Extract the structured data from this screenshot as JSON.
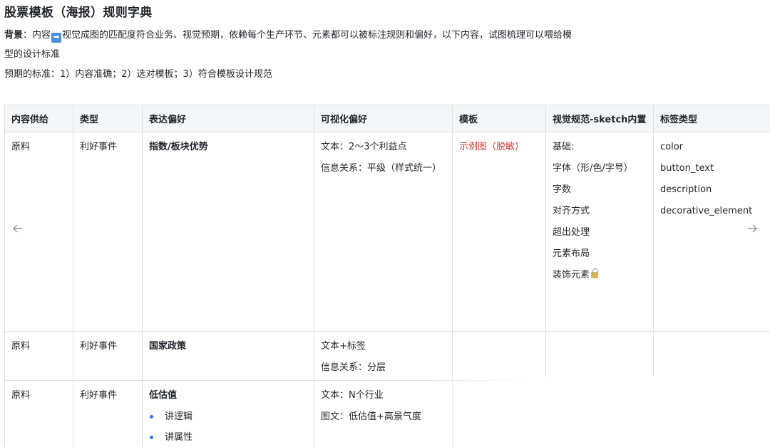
{
  "doc": {
    "title": "股票模板（海报）规则字典",
    "background_label": "背景",
    "background_colon": "：",
    "background_text_a": "内容",
    "background_text_b": "视觉成图的匹配度符合业务、视觉预期，依赖每个生产环节、元素都可以被标注规则和偏好，以下内容，试图梳理可以喂给模型的设计标准",
    "standard_line": "预期的标准：1）内容准确；2）选对模板；3）符合模板设计规范"
  },
  "icons": {
    "arrow_emoji": "right-arrow-emoji-icon",
    "lock": "lock-icon",
    "prev": "arrow-left-icon",
    "next": "arrow-right-icon"
  },
  "colors": {
    "header_bg": "#f5f6f7",
    "border": "#dee0e3",
    "link_red": "#d83931",
    "bullet_blue": "#3370ff"
  },
  "table": {
    "headers": [
      "内容供给",
      "类型",
      "表达偏好",
      "可视化偏好",
      "模板",
      "视觉规范-sketch内置",
      "标签类型"
    ],
    "rows": [
      {
        "supply": "原料",
        "type": "利好事件",
        "expression": "指数/板块优势",
        "visual": [
          "文本：2～3个利益点",
          "信息关系：平级（样式统一）"
        ],
        "template": "示例图（脱敏）",
        "spec": [
          "基础:",
          "字体（形/色/字号）",
          "字数",
          "对齐方式",
          "超出处理",
          "元素布局",
          "装饰元素"
        ],
        "tags": [
          "color",
          "button_text",
          "description",
          "decorative_element"
        ]
      },
      {
        "supply": "原料",
        "type": "利好事件",
        "expression": "国家政策",
        "visual": [
          "文本+标签",
          "信息关系：分层"
        ]
      },
      {
        "supply": "原料",
        "type": "利好事件",
        "expression": "低估值",
        "expression_bullets": [
          "讲逻辑",
          "讲属性"
        ],
        "visual": [
          "文本：N个行业",
          "图文：低估值+高景气度"
        ]
      }
    ]
  }
}
